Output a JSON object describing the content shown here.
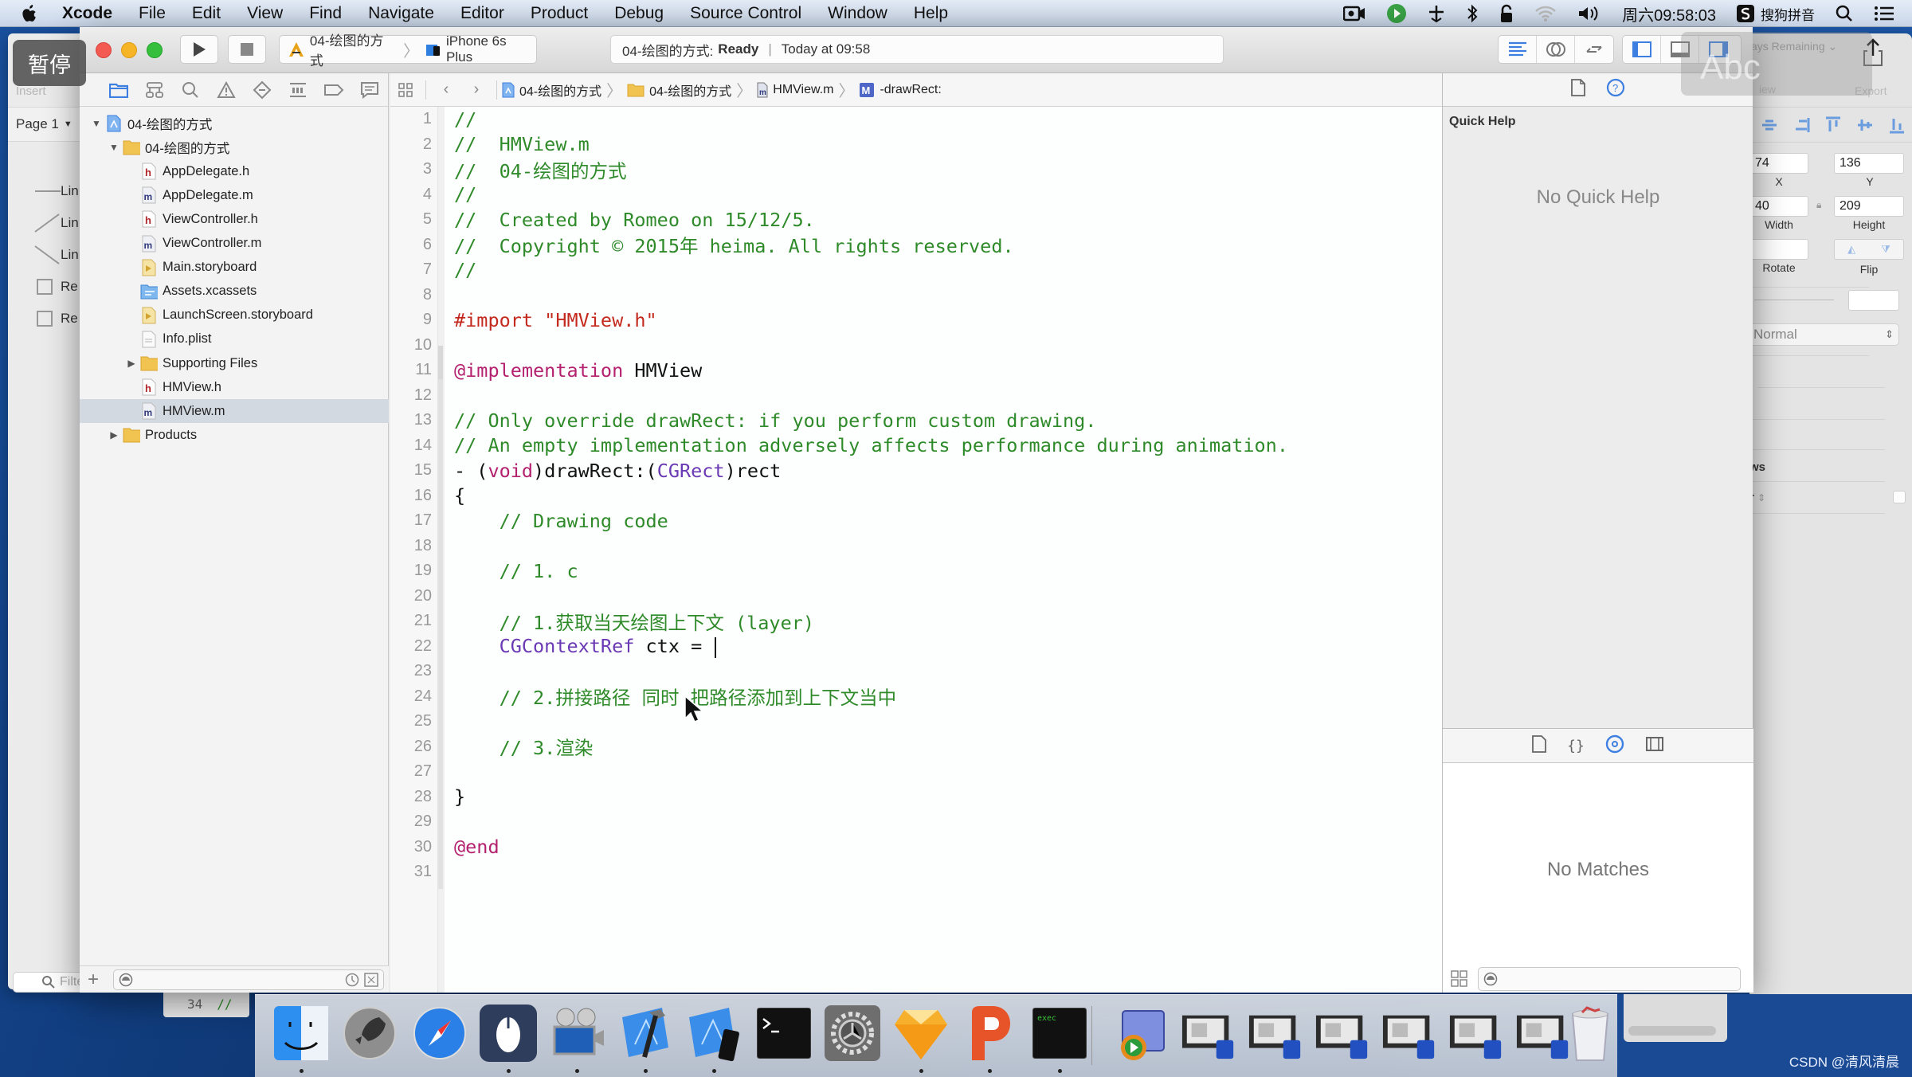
{
  "menubar": {
    "app_name": "Xcode",
    "items": [
      "File",
      "Edit",
      "View",
      "Find",
      "Navigate",
      "Editor",
      "Product",
      "Debug",
      "Source Control",
      "Window",
      "Help"
    ],
    "clock": "周六09:58:03",
    "input_method": "搜狗拼音",
    "status_icons": [
      "screen-record-icon",
      "player-icon",
      "network-plus-icon",
      "bluetooth-icon",
      "lock-icon",
      "wifi-icon",
      "volume-icon"
    ]
  },
  "overlay": {
    "pause_label": "暂停"
  },
  "toolbar": {
    "scheme_name": "04-绘图的方式",
    "destination": "iPhone 6s Plus",
    "activity_project": "04-绘图的方式:",
    "activity_status": "Ready",
    "activity_time": "Today at 09:58"
  },
  "navigator": {
    "tree": [
      {
        "label": "04-绘图的方式",
        "type": "project",
        "level": 0,
        "expanded": true
      },
      {
        "label": "04-绘图的方式",
        "type": "folder",
        "level": 1,
        "expanded": true
      },
      {
        "label": "AppDelegate.h",
        "type": "h",
        "level": 2
      },
      {
        "label": "AppDelegate.m",
        "type": "m",
        "level": 2
      },
      {
        "label": "ViewController.h",
        "type": "h",
        "level": 2
      },
      {
        "label": "ViewController.m",
        "type": "m",
        "level": 2
      },
      {
        "label": "Main.storyboard",
        "type": "storyboard",
        "level": 2
      },
      {
        "label": "Assets.xcassets",
        "type": "assets",
        "level": 2
      },
      {
        "label": "LaunchScreen.storyboard",
        "type": "storyboard",
        "level": 2
      },
      {
        "label": "Info.plist",
        "type": "plist",
        "level": 2
      },
      {
        "label": "Supporting Files",
        "type": "folder",
        "level": 2,
        "expanded": false
      },
      {
        "label": "HMView.h",
        "type": "h",
        "level": 2
      },
      {
        "label": "HMView.m",
        "type": "m",
        "level": 2,
        "selected": true
      },
      {
        "label": "Products",
        "type": "folder",
        "level": 1,
        "expanded": false
      }
    ]
  },
  "jumpbar": {
    "crumbs": [
      "04-绘图的方式",
      "04-绘图的方式",
      "HMView.m",
      "-drawRect:"
    ]
  },
  "editor": {
    "lines": [
      [
        {
          "t": "//",
          "c": "com"
        }
      ],
      [
        {
          "t": "//  HMView.m",
          "c": "com"
        }
      ],
      [
        {
          "t": "//  04-绘图的方式",
          "c": "com"
        }
      ],
      [
        {
          "t": "//",
          "c": "com"
        }
      ],
      [
        {
          "t": "//  Created by Romeo on 15/12/5.",
          "c": "com"
        }
      ],
      [
        {
          "t": "//  Copyright © 2015年 heima. All rights reserved.",
          "c": "com"
        }
      ],
      [
        {
          "t": "//",
          "c": "com"
        }
      ],
      [],
      [
        {
          "t": "#import ",
          "c": "str"
        },
        {
          "t": "\"HMView.h\"",
          "c": "str"
        }
      ],
      [],
      [
        {
          "t": "@implementation",
          "c": "kw"
        },
        {
          "t": " HMView",
          "c": "plain"
        }
      ],
      [],
      [
        {
          "t": "// Only override drawRect: if you perform custom drawing.",
          "c": "com"
        }
      ],
      [
        {
          "t": "// An empty implementation adversely affects performance during animation.",
          "c": "com"
        }
      ],
      [
        {
          "t": "- (",
          "c": "plain"
        },
        {
          "t": "void",
          "c": "kw"
        },
        {
          "t": ")drawRect:(",
          "c": "plain"
        },
        {
          "t": "CGRect",
          "c": "type"
        },
        {
          "t": ")rect",
          "c": "plain"
        }
      ],
      [
        {
          "t": "{",
          "c": "plain"
        }
      ],
      [
        {
          "t": "    // Drawing code",
          "c": "com"
        }
      ],
      [],
      [
        {
          "t": "    // 1. c",
          "c": "com"
        }
      ],
      [],
      [
        {
          "t": "    // 1.获取当天绘图上下文 (layer)",
          "c": "com"
        }
      ],
      [
        {
          "t": "    ",
          "c": "plain"
        },
        {
          "t": "CGContextRef",
          "c": "type"
        },
        {
          "t": " ctx = ",
          "c": "plain"
        },
        {
          "caret": true
        }
      ],
      [],
      [
        {
          "t": "    // 2.拼接路径 同时 把路径添加到上下文当中",
          "c": "com"
        }
      ],
      [],
      [
        {
          "t": "    // 3.渲染",
          "c": "com"
        }
      ],
      [],
      [
        {
          "t": "}",
          "c": "plain"
        }
      ],
      [],
      [
        {
          "t": "@end",
          "c": "kw"
        }
      ],
      []
    ]
  },
  "utilities": {
    "quick_help_title": "Quick Help",
    "quick_help_empty": "No Quick Help",
    "library_empty": "No Matches"
  },
  "sketch": {
    "insert_label": "Insert",
    "page_label": "Page 1",
    "layers": [
      "Lin",
      "Lin",
      "Lin",
      "Re",
      "Re"
    ],
    "filter_placeholder": "Filte",
    "trial_label": "ays Remaining",
    "view_label": "iew",
    "export_label": "Export",
    "x_value": "74",
    "y_value": "136",
    "width_value": "40",
    "height_value": "209",
    "x_label": "X",
    "y_label": "Y",
    "width_label": "Width",
    "height_label": "Height",
    "rotate_label": "Rotate",
    "flip_label": "Flip",
    "blend_mode": "Normal",
    "section_fragment": "ws",
    "row_fragment": "r",
    "behind_line_no": "34",
    "behind_code": "//"
  },
  "dock": {
    "items": [
      {
        "name": "Finder",
        "running": true
      },
      {
        "name": "Launchpad",
        "running": false
      },
      {
        "name": "Safari",
        "running": false
      },
      {
        "name": "Mouse App",
        "running": true
      },
      {
        "name": "Video Editor",
        "running": true
      },
      {
        "name": "Xcode",
        "running": true
      },
      {
        "name": "Simulator",
        "running": true
      },
      {
        "name": "Terminal",
        "running": false
      },
      {
        "name": "System Preferences",
        "running": false
      },
      {
        "name": "Sketch",
        "running": true
      },
      {
        "name": "PowerPoint-like App",
        "running": true
      },
      {
        "name": "Console",
        "running": true
      }
    ],
    "minimized_count": 6
  },
  "watermark": "CSDN @清风清晨"
}
